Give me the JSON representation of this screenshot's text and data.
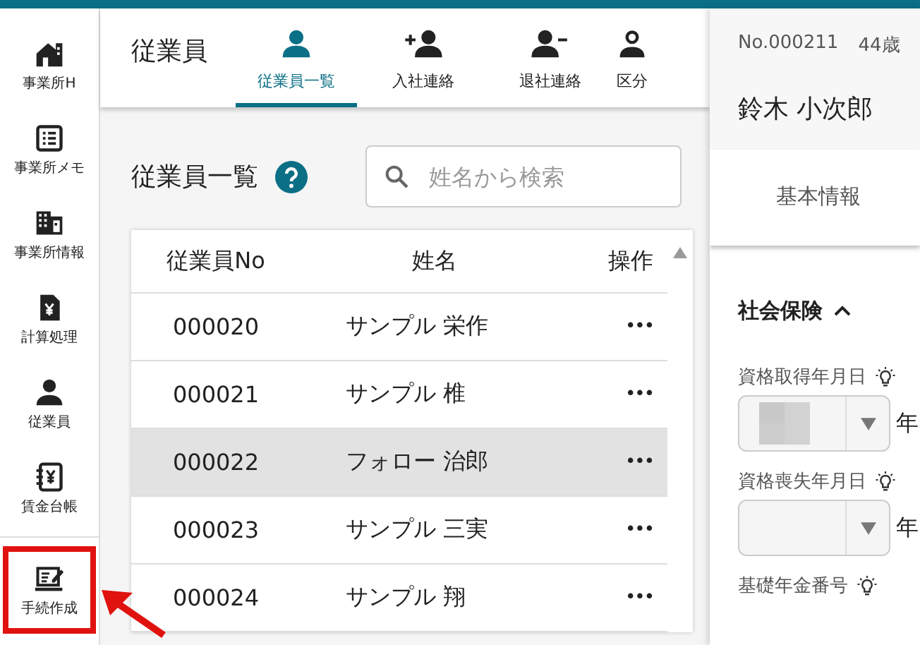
{
  "sidebar": {
    "items": [
      {
        "label": "事業所H",
        "highlighted": false
      },
      {
        "label": "事業所メモ",
        "highlighted": false
      },
      {
        "label": "事業所情報",
        "highlighted": false
      },
      {
        "label": "計算処理",
        "highlighted": false
      },
      {
        "label": "従業員",
        "highlighted": false
      },
      {
        "label": "賃金台帳",
        "highlighted": false
      },
      {
        "label": "手続作成",
        "highlighted": true
      }
    ]
  },
  "header": {
    "title": "従業員",
    "tabs": [
      {
        "label": "従業員一覧",
        "selected": true
      },
      {
        "label": "入社連絡",
        "selected": false
      },
      {
        "label": "退社連絡",
        "selected": false
      },
      {
        "label": "区分",
        "selected": false
      }
    ]
  },
  "list": {
    "title": "従業員一覧",
    "search": {
      "placeholder": "姓名から検索"
    },
    "table": {
      "columns": [
        "従業員No",
        "姓名",
        "操作"
      ],
      "rows": [
        {
          "no": "000020",
          "name": "サンプル 栄作",
          "action": "•••",
          "selected": false
        },
        {
          "no": "000021",
          "name": "サンプル 椎",
          "action": "•••",
          "selected": false
        },
        {
          "no": "000022",
          "name": "フォロー 治郎",
          "action": "•••",
          "selected": true
        },
        {
          "no": "000023",
          "name": "サンプル 三実",
          "action": "•••",
          "selected": false
        },
        {
          "no": "000024",
          "name": "サンプル 翔",
          "action": "•••",
          "selected": false
        }
      ]
    }
  },
  "detail": {
    "number": "No.000211",
    "age": "44歳",
    "name": "鈴木 小次郎",
    "tabs": [
      {
        "label": "基本情報",
        "selected": false
      }
    ],
    "section": {
      "title": "社会保険",
      "expanded": true
    },
    "fields": [
      {
        "kind": "date",
        "label": "資格取得年月日",
        "filled": true,
        "unit": "年"
      },
      {
        "kind": "date",
        "label": "資格喪失年月日",
        "filled": false,
        "unit": "年"
      },
      {
        "kind": "text",
        "label": "基礎年金番号"
      }
    ]
  }
}
